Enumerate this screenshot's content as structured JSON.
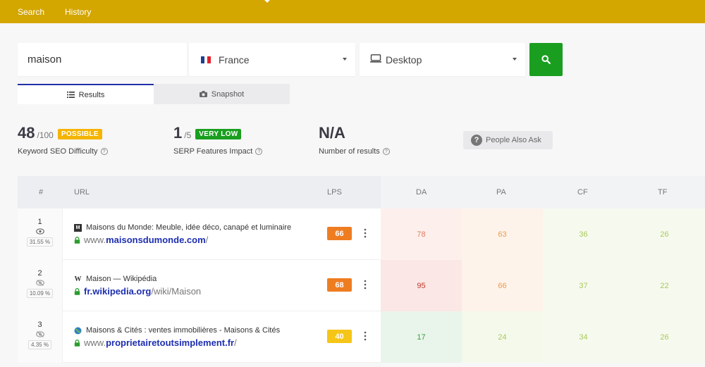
{
  "nav": {
    "search": "Search",
    "history": "History"
  },
  "search": {
    "keyword": "maison",
    "country": "France",
    "device": "Desktop",
    "flag_colors": [
      "#1c3f94",
      "#ffffff",
      "#e1232b"
    ]
  },
  "tabs": {
    "results": "Results",
    "snapshot": "Snapshot"
  },
  "metrics": {
    "difficulty": {
      "value": "48",
      "max": "/100",
      "badge": "POSSIBLE",
      "badge_color": "#f4b400",
      "caption": "Keyword SEO Difficulty",
      "help": "?"
    },
    "serp": {
      "value": "1",
      "max": "/5",
      "badge": "VERY LOW",
      "badge_color": "#1a9e1f",
      "caption": "SERP Features Impact",
      "help": "?"
    },
    "results": {
      "value": "N/A",
      "caption": "Number of results",
      "help": "?"
    }
  },
  "paa": {
    "icon": "?",
    "label": "People Also Ask"
  },
  "table": {
    "headers": {
      "num": "#",
      "url": "URL",
      "lps": "LPS",
      "da": "DA",
      "pa": "PA",
      "cf": "CF",
      "tf": "TF"
    },
    "rows": [
      {
        "rank": "1",
        "visibility": "31.55 %",
        "visible": true,
        "favicon": "M",
        "title": "Maisons du Monde: Meuble, idée déco, canapé et luminaire",
        "url_prefix": "www.",
        "domain": "maisonsdumonde.com",
        "path": "/",
        "lps": "66",
        "lps_color": "#ee7d22",
        "da": "78",
        "pa": "63",
        "cf": "36",
        "tf": "26",
        "colors": {
          "da": "#e07a5f",
          "pa": "#e99a4d",
          "cf": "#a9c95a",
          "tf": "#a9c95a"
        },
        "bgs": {
          "da": "#fdf0ec",
          "pa": "#fdf3ea",
          "cf": "#f6faee",
          "tf": "#f6faee"
        }
      },
      {
        "rank": "2",
        "visibility": "10.09 %",
        "visible": false,
        "favicon": "W",
        "title": "Maison — Wikipédia",
        "url_prefix": "",
        "domain": "fr.wikipedia.org",
        "path": "/wiki/Maison",
        "lps": "68",
        "lps_color": "#ee7d22",
        "da": "95",
        "pa": "66",
        "cf": "37",
        "tf": "22",
        "colors": {
          "da": "#c0392b",
          "pa": "#e99a4d",
          "cf": "#a9c95a",
          "tf": "#a9c95a"
        },
        "bgs": {
          "da": "#fbe7e5",
          "pa": "#fdf3ea",
          "cf": "#f6faee",
          "tf": "#f6faee"
        }
      },
      {
        "rank": "3",
        "visibility": "4.35 %",
        "visible": false,
        "favicon": "",
        "title": "Maisons & Cités : ventes immobilières - Maisons & Cités",
        "url_prefix": "www.",
        "domain": "proprietairetoutsimplement.fr",
        "path": "/",
        "lps": "40",
        "lps_color": "#f5c518",
        "da": "17",
        "pa": "24",
        "cf": "34",
        "tf": "26",
        "colors": {
          "da": "#3f9b45",
          "pa": "#a9c95a",
          "cf": "#a9c95a",
          "tf": "#a9c95a"
        },
        "bgs": {
          "da": "#e9f5ea",
          "pa": "#f4f9ec",
          "cf": "#f6faee",
          "tf": "#f6faee"
        }
      }
    ]
  }
}
